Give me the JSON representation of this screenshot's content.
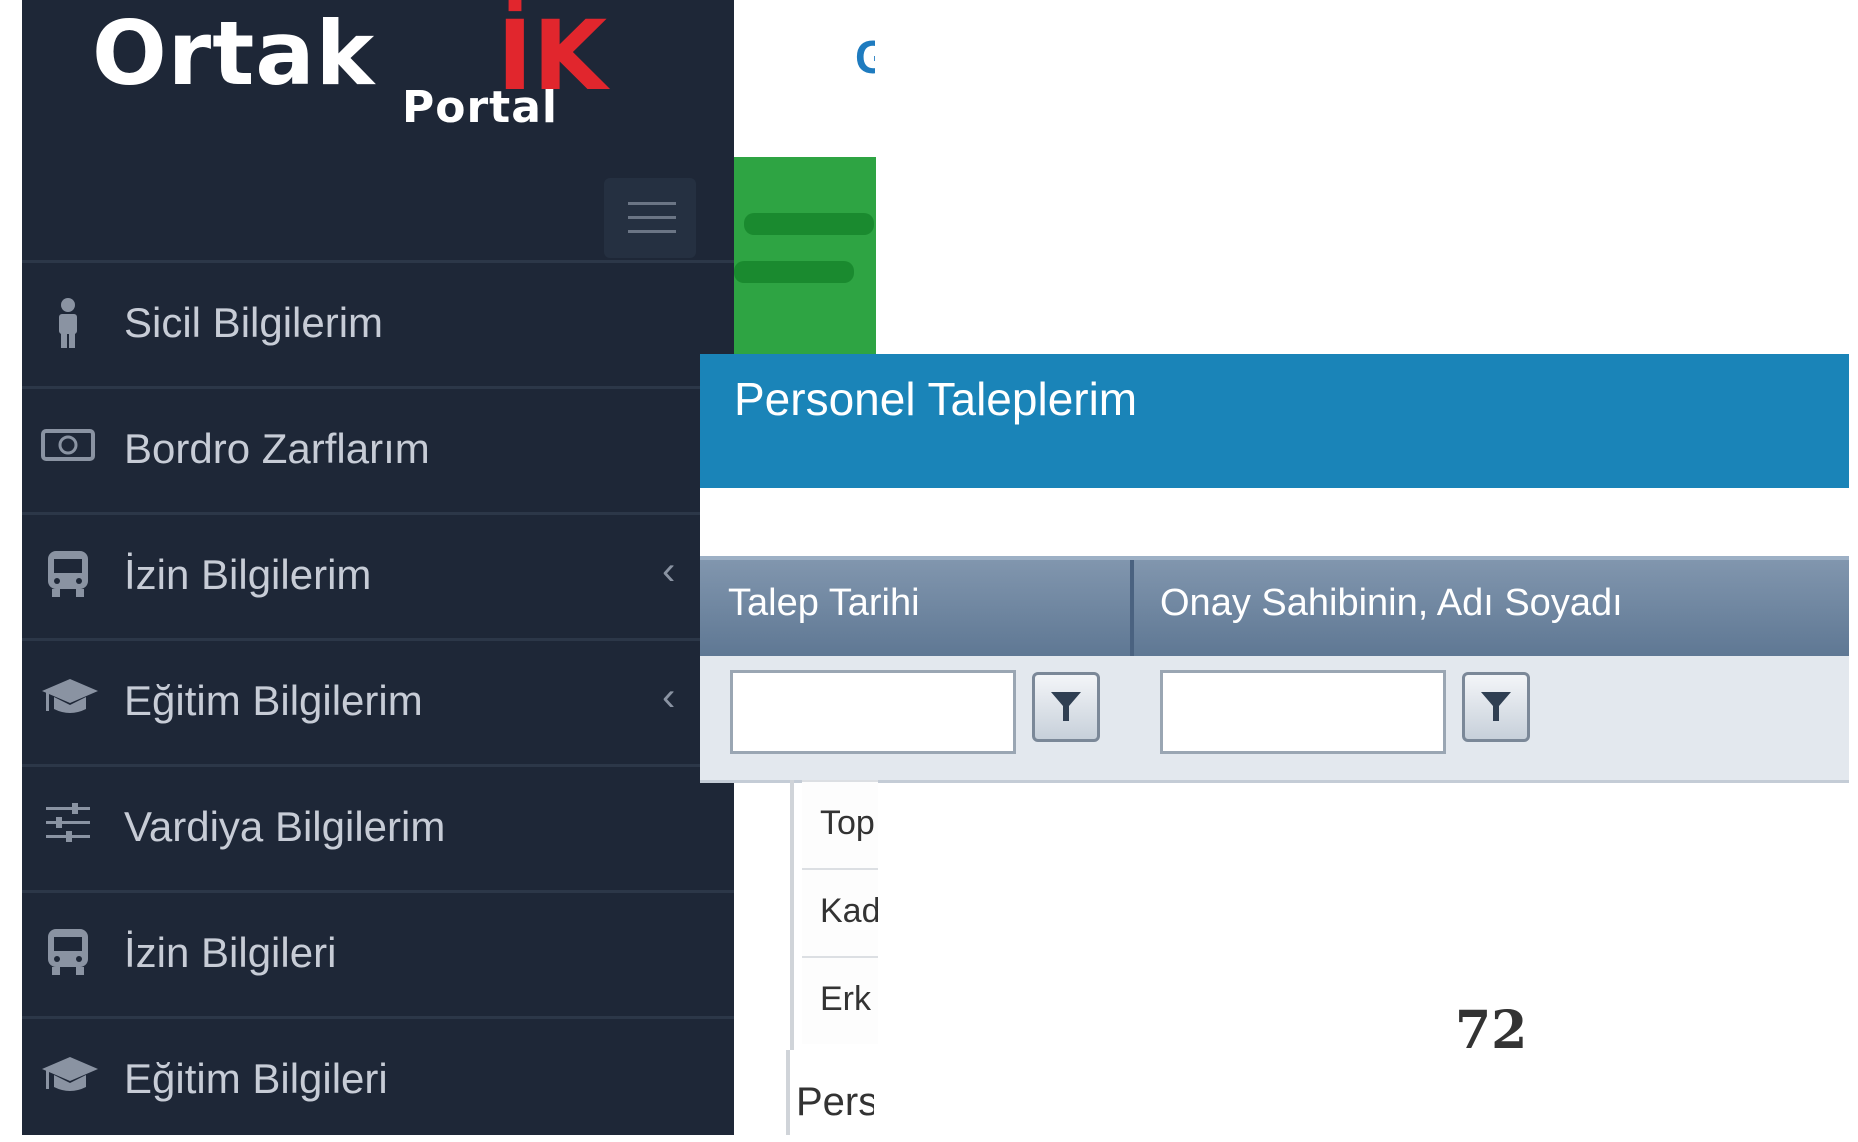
{
  "logo": {
    "brand": "Ortak",
    "accent": "İK",
    "sub": "Portal"
  },
  "sidebar": {
    "items": [
      {
        "label": "Sicil Bilgilerim",
        "icon": "person-icon",
        "chevron": false
      },
      {
        "label": "Bordro Zarflarım",
        "icon": "money-icon",
        "chevron": false
      },
      {
        "label": "İzin Bilgilerim",
        "icon": "bus-icon",
        "chevron": true
      },
      {
        "label": "Eğitim Bilgilerim",
        "icon": "graduation-cap-icon",
        "chevron": true
      },
      {
        "label": "Vardiya Bilgilerim",
        "icon": "sliders-icon",
        "chevron": false
      },
      {
        "label": "İzin Bilgileri",
        "icon": "bus-icon",
        "chevron": false
      },
      {
        "label": "Eğitim Bilgileri",
        "icon": "graduation-cap-icon",
        "chevron": false
      }
    ]
  },
  "panel": {
    "title": "Personel Taleplerim",
    "columns": [
      "Talep Tarihi",
      "Onay Sahibinin, Adı Soyadı"
    ]
  },
  "stats": {
    "rows": [
      "Top",
      "Kad",
      "Erk"
    ],
    "footer": "Pers"
  },
  "partial_header_glyph": "G",
  "page_number": "72",
  "colors": {
    "sidebar_bg": "#1e2737",
    "panel_header": "#1a84b8",
    "green_widget": "#2ea443",
    "logo_accent": "#e1262d"
  }
}
